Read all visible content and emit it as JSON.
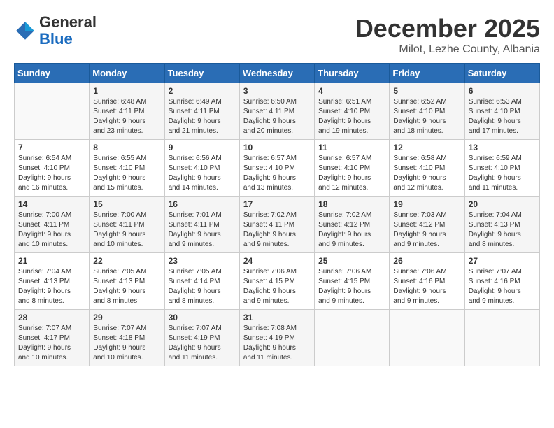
{
  "header": {
    "logo_general": "General",
    "logo_blue": "Blue",
    "month": "December 2025",
    "location": "Milot, Lezhe County, Albania"
  },
  "days_of_week": [
    "Sunday",
    "Monday",
    "Tuesday",
    "Wednesday",
    "Thursday",
    "Friday",
    "Saturday"
  ],
  "weeks": [
    [
      {
        "day": "",
        "info": ""
      },
      {
        "day": "1",
        "info": "Sunrise: 6:48 AM\nSunset: 4:11 PM\nDaylight: 9 hours\nand 23 minutes."
      },
      {
        "day": "2",
        "info": "Sunrise: 6:49 AM\nSunset: 4:11 PM\nDaylight: 9 hours\nand 21 minutes."
      },
      {
        "day": "3",
        "info": "Sunrise: 6:50 AM\nSunset: 4:11 PM\nDaylight: 9 hours\nand 20 minutes."
      },
      {
        "day": "4",
        "info": "Sunrise: 6:51 AM\nSunset: 4:10 PM\nDaylight: 9 hours\nand 19 minutes."
      },
      {
        "day": "5",
        "info": "Sunrise: 6:52 AM\nSunset: 4:10 PM\nDaylight: 9 hours\nand 18 minutes."
      },
      {
        "day": "6",
        "info": "Sunrise: 6:53 AM\nSunset: 4:10 PM\nDaylight: 9 hours\nand 17 minutes."
      }
    ],
    [
      {
        "day": "7",
        "info": "Sunrise: 6:54 AM\nSunset: 4:10 PM\nDaylight: 9 hours\nand 16 minutes."
      },
      {
        "day": "8",
        "info": "Sunrise: 6:55 AM\nSunset: 4:10 PM\nDaylight: 9 hours\nand 15 minutes."
      },
      {
        "day": "9",
        "info": "Sunrise: 6:56 AM\nSunset: 4:10 PM\nDaylight: 9 hours\nand 14 minutes."
      },
      {
        "day": "10",
        "info": "Sunrise: 6:57 AM\nSunset: 4:10 PM\nDaylight: 9 hours\nand 13 minutes."
      },
      {
        "day": "11",
        "info": "Sunrise: 6:57 AM\nSunset: 4:10 PM\nDaylight: 9 hours\nand 12 minutes."
      },
      {
        "day": "12",
        "info": "Sunrise: 6:58 AM\nSunset: 4:10 PM\nDaylight: 9 hours\nand 12 minutes."
      },
      {
        "day": "13",
        "info": "Sunrise: 6:59 AM\nSunset: 4:10 PM\nDaylight: 9 hours\nand 11 minutes."
      }
    ],
    [
      {
        "day": "14",
        "info": "Sunrise: 7:00 AM\nSunset: 4:11 PM\nDaylight: 9 hours\nand 10 minutes."
      },
      {
        "day": "15",
        "info": "Sunrise: 7:00 AM\nSunset: 4:11 PM\nDaylight: 9 hours\nand 10 minutes."
      },
      {
        "day": "16",
        "info": "Sunrise: 7:01 AM\nSunset: 4:11 PM\nDaylight: 9 hours\nand 9 minutes."
      },
      {
        "day": "17",
        "info": "Sunrise: 7:02 AM\nSunset: 4:11 PM\nDaylight: 9 hours\nand 9 minutes."
      },
      {
        "day": "18",
        "info": "Sunrise: 7:02 AM\nSunset: 4:12 PM\nDaylight: 9 hours\nand 9 minutes."
      },
      {
        "day": "19",
        "info": "Sunrise: 7:03 AM\nSunset: 4:12 PM\nDaylight: 9 hours\nand 9 minutes."
      },
      {
        "day": "20",
        "info": "Sunrise: 7:04 AM\nSunset: 4:13 PM\nDaylight: 9 hours\nand 8 minutes."
      }
    ],
    [
      {
        "day": "21",
        "info": "Sunrise: 7:04 AM\nSunset: 4:13 PM\nDaylight: 9 hours\nand 8 minutes."
      },
      {
        "day": "22",
        "info": "Sunrise: 7:05 AM\nSunset: 4:13 PM\nDaylight: 9 hours\nand 8 minutes."
      },
      {
        "day": "23",
        "info": "Sunrise: 7:05 AM\nSunset: 4:14 PM\nDaylight: 9 hours\nand 8 minutes."
      },
      {
        "day": "24",
        "info": "Sunrise: 7:06 AM\nSunset: 4:15 PM\nDaylight: 9 hours\nand 9 minutes."
      },
      {
        "day": "25",
        "info": "Sunrise: 7:06 AM\nSunset: 4:15 PM\nDaylight: 9 hours\nand 9 minutes."
      },
      {
        "day": "26",
        "info": "Sunrise: 7:06 AM\nSunset: 4:16 PM\nDaylight: 9 hours\nand 9 minutes."
      },
      {
        "day": "27",
        "info": "Sunrise: 7:07 AM\nSunset: 4:16 PM\nDaylight: 9 hours\nand 9 minutes."
      }
    ],
    [
      {
        "day": "28",
        "info": "Sunrise: 7:07 AM\nSunset: 4:17 PM\nDaylight: 9 hours\nand 10 minutes."
      },
      {
        "day": "29",
        "info": "Sunrise: 7:07 AM\nSunset: 4:18 PM\nDaylight: 9 hours\nand 10 minutes."
      },
      {
        "day": "30",
        "info": "Sunrise: 7:07 AM\nSunset: 4:19 PM\nDaylight: 9 hours\nand 11 minutes."
      },
      {
        "day": "31",
        "info": "Sunrise: 7:08 AM\nSunset: 4:19 PM\nDaylight: 9 hours\nand 11 minutes."
      },
      {
        "day": "",
        "info": ""
      },
      {
        "day": "",
        "info": ""
      },
      {
        "day": "",
        "info": ""
      }
    ]
  ]
}
